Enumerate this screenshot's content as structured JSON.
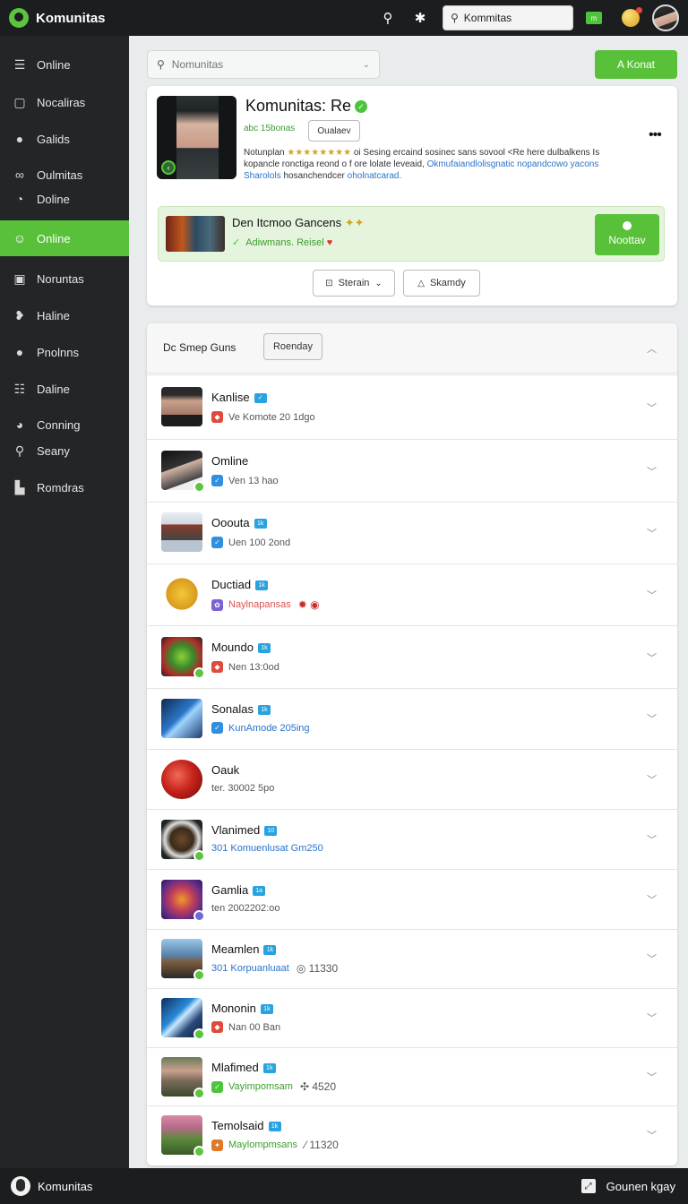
{
  "app": {
    "name": "Komunitas"
  },
  "header": {
    "search_value": "Kommitas",
    "chip_text": "m",
    "icons": [
      "search-icon",
      "settings-icon",
      "coin-icon",
      "avatar"
    ]
  },
  "sidebar": {
    "items": [
      {
        "label": "Online",
        "icon": "☰"
      },
      {
        "label": "Nocaliras",
        "icon": "▢"
      },
      {
        "label": "Galids",
        "icon": "●"
      },
      {
        "label": "Oulmitas",
        "icon": "∞"
      },
      {
        "label": "Doline",
        "icon": "◔"
      },
      {
        "label": "Online",
        "icon": "☺",
        "active": true
      },
      {
        "label": "Noruntas",
        "icon": "▣"
      },
      {
        "label": "Haline",
        "icon": "❥"
      },
      {
        "label": "Pnolnns",
        "icon": "●"
      },
      {
        "label": "Daline",
        "icon": "☷"
      },
      {
        "label": "Conning",
        "icon": "◕"
      },
      {
        "label": "Seany",
        "icon": "⚲"
      },
      {
        "label": "Romdras",
        "icon": "▙"
      }
    ]
  },
  "main": {
    "search_placeholder": "Nomunitas",
    "action_label": "A Konat"
  },
  "profile": {
    "title": "Komunitas: Re",
    "sub": "abc 15bonas",
    "small_btn": "Oualaev",
    "desc_a": "Notunplan ",
    "desc_stars": "★★★★★★★★",
    "desc_b": " oi Sesing ercaind sosinec sans sovool <Re here dulbalkens Is kopancle ronctiga reond o f ore lolate leveaid, ",
    "desc_link": "Okmufaiandlolisgnatic nopandcowo yacons Sharolols",
    "desc_c": " hosanchendcer ",
    "desc_link2": "oholnatcarad."
  },
  "promo": {
    "title": "Den Itcmoo Gancens",
    "title_emoji": "✦✦",
    "sub": "Adiwmans. Reisel",
    "sub_emoji": "♥",
    "btn_label": "Noottav"
  },
  "buttons": {
    "stream_label": "Sterain",
    "share_label": "Skamdy"
  },
  "list": {
    "title": "Dc Smep Guns",
    "filter_label": "Roenday",
    "rows": [
      {
        "name": "Kanlise",
        "tag": "✓",
        "meta_icon": "red",
        "meta": "Ve Komote 20 1dgo",
        "extra": ""
      },
      {
        "name": "Omline",
        "tag": "",
        "meta_icon": "blue",
        "meta": "Ven 13 hao",
        "extra": ""
      },
      {
        "name": "Ooouta",
        "tag": "1k",
        "meta_icon": "blue",
        "meta": "Uen 100 2ond",
        "extra": ""
      },
      {
        "name": "Ductiad",
        "tag": "1k",
        "meta_icon": "multi",
        "meta": "Naylnapansas",
        "extra": "✹ ◉"
      },
      {
        "name": "Moundo",
        "tag": "1k",
        "meta_icon": "red",
        "meta": "Nen 13:0od",
        "extra": ""
      },
      {
        "name": "Sonalas",
        "tag": "1k",
        "meta_icon": "blue",
        "meta": "KunAmode 205ing",
        "extra": ""
      },
      {
        "name": "Oauk",
        "tag": "",
        "meta_icon": "none",
        "meta": "ter. 30002 5po",
        "extra": ""
      },
      {
        "name": "Vlanimed",
        "tag": "10",
        "meta_icon": "none",
        "meta": "301 Komuenlusat Gm250",
        "extra": ""
      },
      {
        "name": "Gamlia",
        "tag": "1a",
        "meta_icon": "none",
        "meta": "ten 2002202:oo",
        "extra": ""
      },
      {
        "name": "Meamlen",
        "tag": "1k",
        "meta_icon": "none",
        "meta": "301 Korpuanluaat",
        "extra": "◎ 11330"
      },
      {
        "name": "Mononin",
        "tag": "1k",
        "meta_icon": "red",
        "meta": "Nan 00 Ban",
        "extra": ""
      },
      {
        "name": "Mlafimed",
        "tag": "1k",
        "meta_icon": "green",
        "meta": "Vayimpomsam",
        "extra": "✣ 4520"
      },
      {
        "name": "Temolsaid",
        "tag": "1k",
        "meta_icon": "orange",
        "meta": "Maylompmsans",
        "extra": "⁄ 11320"
      }
    ]
  },
  "footer": {
    "name": "Komunitas",
    "right_label": "Gounen kgay"
  },
  "colors": {
    "accent": "#58c139",
    "sidebar": "#232527",
    "topbar": "#1b1d1f",
    "link": "#2a73c9"
  }
}
